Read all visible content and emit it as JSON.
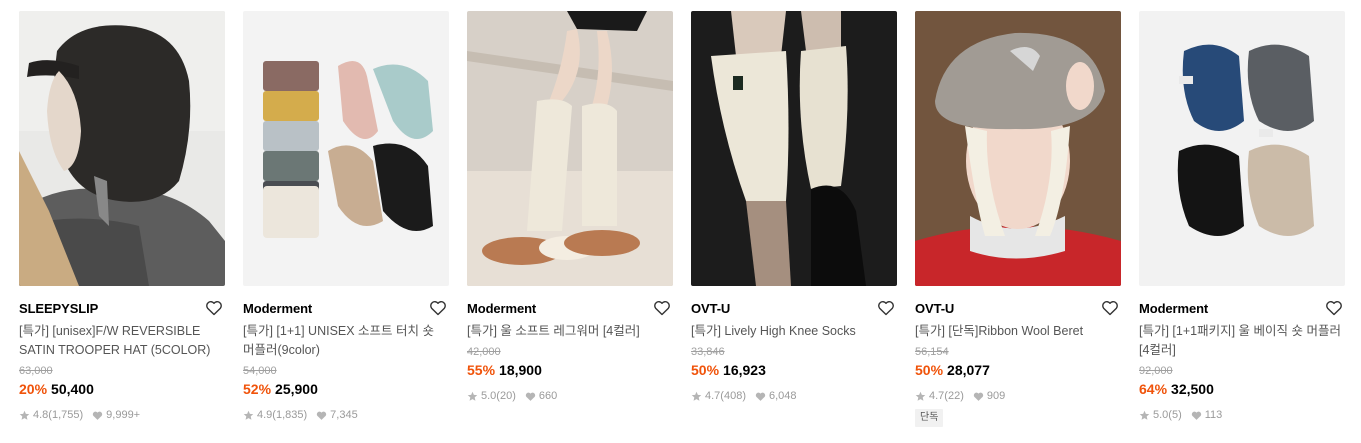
{
  "products": [
    {
      "image": "sleepyslip-trooper-hat-photo",
      "brand": "SLEEPYSLIP",
      "title": "[특가] [unisex]F/W REVERSIBLE SATIN TROOPER HAT (5COLOR)",
      "original_price": "63,000",
      "discount": "20%",
      "price": "50,400",
      "rating": "4.8",
      "review_count": "(1,755)",
      "likes": "9,999+"
    },
    {
      "image": "moderment-soft-touch-muffler-photo",
      "brand": "Moderment",
      "title": "[특가] [1+1] UNISEX 소프트 터치 숏 머플러(9color)",
      "original_price": "54,000",
      "discount": "52%",
      "price": "25,900",
      "rating": "4.9",
      "review_count": "(1,835)",
      "likes": "7,345"
    },
    {
      "image": "moderment-wool-leg-warmer-photo",
      "brand": "Moderment",
      "title": "[특가] 울 소프트 레그워머 [4컬러]",
      "original_price": "42,000",
      "discount": "55%",
      "price": "18,900",
      "rating": "5.0",
      "review_count": "(20)",
      "likes": "660"
    },
    {
      "image": "ovtu-knee-socks-photo",
      "brand": "OVT-U",
      "title": "[특가] Lively High Knee Socks",
      "original_price": "33,846",
      "discount": "50%",
      "price": "16,923",
      "rating": "4.7",
      "review_count": "(408)",
      "likes": "6,048"
    },
    {
      "image": "ovtu-ribbon-wool-beret-photo",
      "brand": "OVT-U",
      "title": "[특가] [단독]Ribbon Wool Beret",
      "original_price": "56,154",
      "discount": "50%",
      "price": "28,077",
      "rating": "4.7",
      "review_count": "(22)",
      "likes": "909",
      "tag": "단독"
    },
    {
      "image": "moderment-beige-short-muffler-photo",
      "brand": "Moderment",
      "title": "[특가] [1+1패키지] 울 베이직 숏 머플러 [4컬러]",
      "original_price": "92,000",
      "discount": "64%",
      "price": "32,500",
      "rating": "5.0",
      "review_count": "(5)",
      "likes": "113"
    }
  ],
  "icons": {
    "like": "heart-outline-icon",
    "rating": "star-icon",
    "likes": "heart-filled-icon"
  },
  "colors": {
    "discount": "#f0530a",
    "muted": "#9a9a9a",
    "strike": "#a0a0a0"
  }
}
